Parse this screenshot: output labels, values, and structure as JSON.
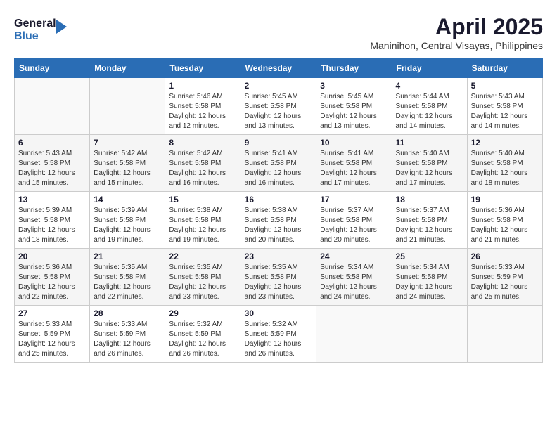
{
  "header": {
    "logo_general": "General",
    "logo_blue": "Blue",
    "month_title": "April 2025",
    "subtitle": "Maninihon, Central Visayas, Philippines"
  },
  "days_of_week": [
    "Sunday",
    "Monday",
    "Tuesday",
    "Wednesday",
    "Thursday",
    "Friday",
    "Saturday"
  ],
  "weeks": [
    [
      {
        "day": "",
        "info": ""
      },
      {
        "day": "",
        "info": ""
      },
      {
        "day": "1",
        "info": "Sunrise: 5:46 AM\nSunset: 5:58 PM\nDaylight: 12 hours\nand 12 minutes."
      },
      {
        "day": "2",
        "info": "Sunrise: 5:45 AM\nSunset: 5:58 PM\nDaylight: 12 hours\nand 13 minutes."
      },
      {
        "day": "3",
        "info": "Sunrise: 5:45 AM\nSunset: 5:58 PM\nDaylight: 12 hours\nand 13 minutes."
      },
      {
        "day": "4",
        "info": "Sunrise: 5:44 AM\nSunset: 5:58 PM\nDaylight: 12 hours\nand 14 minutes."
      },
      {
        "day": "5",
        "info": "Sunrise: 5:43 AM\nSunset: 5:58 PM\nDaylight: 12 hours\nand 14 minutes."
      }
    ],
    [
      {
        "day": "6",
        "info": "Sunrise: 5:43 AM\nSunset: 5:58 PM\nDaylight: 12 hours\nand 15 minutes."
      },
      {
        "day": "7",
        "info": "Sunrise: 5:42 AM\nSunset: 5:58 PM\nDaylight: 12 hours\nand 15 minutes."
      },
      {
        "day": "8",
        "info": "Sunrise: 5:42 AM\nSunset: 5:58 PM\nDaylight: 12 hours\nand 16 minutes."
      },
      {
        "day": "9",
        "info": "Sunrise: 5:41 AM\nSunset: 5:58 PM\nDaylight: 12 hours\nand 16 minutes."
      },
      {
        "day": "10",
        "info": "Sunrise: 5:41 AM\nSunset: 5:58 PM\nDaylight: 12 hours\nand 17 minutes."
      },
      {
        "day": "11",
        "info": "Sunrise: 5:40 AM\nSunset: 5:58 PM\nDaylight: 12 hours\nand 17 minutes."
      },
      {
        "day": "12",
        "info": "Sunrise: 5:40 AM\nSunset: 5:58 PM\nDaylight: 12 hours\nand 18 minutes."
      }
    ],
    [
      {
        "day": "13",
        "info": "Sunrise: 5:39 AM\nSunset: 5:58 PM\nDaylight: 12 hours\nand 18 minutes."
      },
      {
        "day": "14",
        "info": "Sunrise: 5:39 AM\nSunset: 5:58 PM\nDaylight: 12 hours\nand 19 minutes."
      },
      {
        "day": "15",
        "info": "Sunrise: 5:38 AM\nSunset: 5:58 PM\nDaylight: 12 hours\nand 19 minutes."
      },
      {
        "day": "16",
        "info": "Sunrise: 5:38 AM\nSunset: 5:58 PM\nDaylight: 12 hours\nand 20 minutes."
      },
      {
        "day": "17",
        "info": "Sunrise: 5:37 AM\nSunset: 5:58 PM\nDaylight: 12 hours\nand 20 minutes."
      },
      {
        "day": "18",
        "info": "Sunrise: 5:37 AM\nSunset: 5:58 PM\nDaylight: 12 hours\nand 21 minutes."
      },
      {
        "day": "19",
        "info": "Sunrise: 5:36 AM\nSunset: 5:58 PM\nDaylight: 12 hours\nand 21 minutes."
      }
    ],
    [
      {
        "day": "20",
        "info": "Sunrise: 5:36 AM\nSunset: 5:58 PM\nDaylight: 12 hours\nand 22 minutes."
      },
      {
        "day": "21",
        "info": "Sunrise: 5:35 AM\nSunset: 5:58 PM\nDaylight: 12 hours\nand 22 minutes."
      },
      {
        "day": "22",
        "info": "Sunrise: 5:35 AM\nSunset: 5:58 PM\nDaylight: 12 hours\nand 23 minutes."
      },
      {
        "day": "23",
        "info": "Sunrise: 5:35 AM\nSunset: 5:58 PM\nDaylight: 12 hours\nand 23 minutes."
      },
      {
        "day": "24",
        "info": "Sunrise: 5:34 AM\nSunset: 5:58 PM\nDaylight: 12 hours\nand 24 minutes."
      },
      {
        "day": "25",
        "info": "Sunrise: 5:34 AM\nSunset: 5:58 PM\nDaylight: 12 hours\nand 24 minutes."
      },
      {
        "day": "26",
        "info": "Sunrise: 5:33 AM\nSunset: 5:59 PM\nDaylight: 12 hours\nand 25 minutes."
      }
    ],
    [
      {
        "day": "27",
        "info": "Sunrise: 5:33 AM\nSunset: 5:59 PM\nDaylight: 12 hours\nand 25 minutes."
      },
      {
        "day": "28",
        "info": "Sunrise: 5:33 AM\nSunset: 5:59 PM\nDaylight: 12 hours\nand 26 minutes."
      },
      {
        "day": "29",
        "info": "Sunrise: 5:32 AM\nSunset: 5:59 PM\nDaylight: 12 hours\nand 26 minutes."
      },
      {
        "day": "30",
        "info": "Sunrise: 5:32 AM\nSunset: 5:59 PM\nDaylight: 12 hours\nand 26 minutes."
      },
      {
        "day": "",
        "info": ""
      },
      {
        "day": "",
        "info": ""
      },
      {
        "day": "",
        "info": ""
      }
    ]
  ]
}
